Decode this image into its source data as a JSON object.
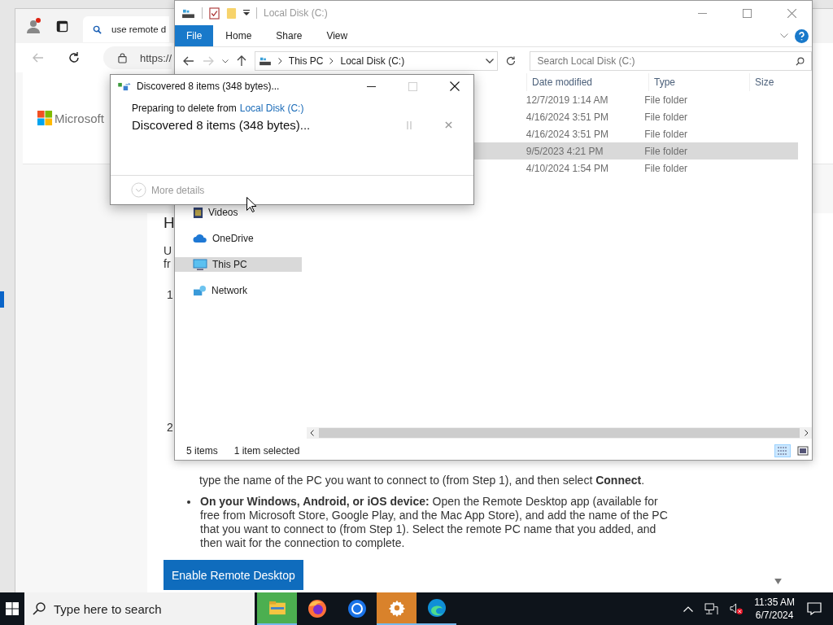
{
  "browser": {
    "tab_title": "use remote d",
    "address": "https://",
    "logo_text": "Microsoft",
    "article": {
      "heading": "H",
      "intro_lines": [
        "U",
        "fr"
      ],
      "step_numbers": [
        "1",
        "2"
      ],
      "step_text": "type the name of the PC you want to connect to (from Step 1), and then select **Connect**.",
      "bullets": [
        "**On your Windows, Android, or iOS device:** Open the Remote Desktop app (available for free from Microsoft Store, Google Play, and the Mac App Store), and add the name of the PC that you want to connect to (from Step 1).  Select the remote PC name that you added, and then wait for the connection to complete."
      ],
      "button": "Enable Remote Desktop"
    }
  },
  "explorer": {
    "title": "Local Disk (C:)",
    "ribbon_tabs": [
      {
        "label": "File",
        "selected": true
      },
      {
        "label": "Home",
        "selected": false
      },
      {
        "label": "Share",
        "selected": false
      },
      {
        "label": "View",
        "selected": false
      }
    ],
    "path": [
      "This PC",
      "Local Disk (C:)"
    ],
    "search": {
      "placeholder": "Search Local Disk (C:)"
    },
    "columns": [
      "Date modified",
      "Type",
      "Size"
    ],
    "rows": [
      {
        "date": "12/7/2019 1:14 AM",
        "type": "File folder",
        "selected": false
      },
      {
        "date": "4/16/2024 3:51 PM",
        "type": "File folder",
        "selected": false
      },
      {
        "date": "4/16/2024 3:51 PM",
        "type": "File folder",
        "selected": false
      },
      {
        "date": "9/5/2023 4:21 PM",
        "type": "File folder",
        "selected": true
      },
      {
        "date": "4/10/2024 1:54 PM",
        "type": "File folder",
        "selected": false
      }
    ],
    "nav": [
      {
        "label": "Videos",
        "kind": "videos",
        "selected": false
      },
      {
        "label": "OneDrive",
        "kind": "cloud",
        "selected": false
      },
      {
        "label": "This PC",
        "kind": "pc",
        "selected": true
      },
      {
        "label": "Network",
        "kind": "network",
        "selected": false
      }
    ],
    "status": {
      "count": "5 items",
      "selection": "1 item selected"
    }
  },
  "dialog": {
    "title": "Discovered 8 items (348 bytes)...",
    "maximize_disabled": true,
    "source_prefix": "Preparing to delete from",
    "source_link": "Local Disk (C:)",
    "status": "Discovered 8 items (348 bytes)...",
    "more_details": "More details"
  },
  "taskbar": {
    "search_placeholder": "Type here to search",
    "apps": [
      {
        "kind": "files",
        "running": true
      },
      {
        "kind": "firefox",
        "running": false
      },
      {
        "kind": "chrome",
        "running": false
      },
      {
        "kind": "settings",
        "running": true
      },
      {
        "kind": "edge",
        "running": true
      }
    ],
    "time": "11:35 AM",
    "date": "6/7/2024"
  }
}
